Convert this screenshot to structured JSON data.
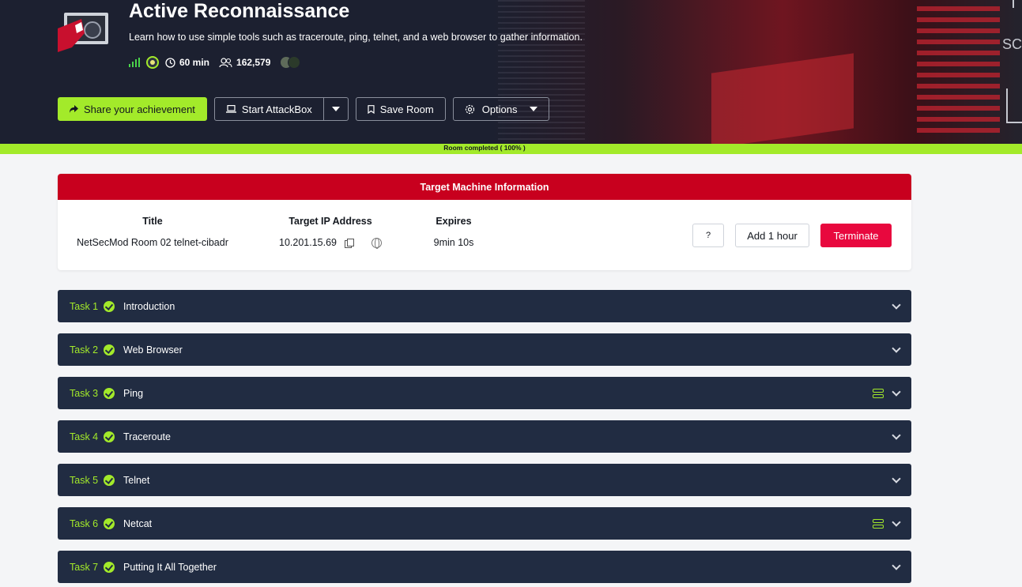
{
  "header": {
    "title": "Active Reconnaissance",
    "description": "Learn how to use simple tools such as traceroute, ping, telnet, and a web browser to gather information.",
    "duration": "60 min",
    "users": "162,579",
    "difficulty_icon": "difficulty-easy-icon",
    "art_text": "SC"
  },
  "actions": {
    "share": "Share your achievement",
    "attackbox": "Start AttackBox",
    "save": "Save Room",
    "options": "Options"
  },
  "progress": {
    "label": "Room completed ( 100% )",
    "percent": 100
  },
  "target_machine": {
    "heading": "Target Machine Information",
    "title_header": "Title",
    "title_value": "NetSecMod Room 02 telnet-cibadr",
    "ip_header": "Target IP Address",
    "ip_value": "10.201.15.69",
    "expires_header": "Expires",
    "expires_value": "9min 10s",
    "help_label": "?",
    "add_hour_label": "Add 1 hour",
    "terminate_label": "Terminate"
  },
  "tasks": [
    {
      "number": "Task 1",
      "name": "Introduction",
      "completed": true,
      "has_machine": false
    },
    {
      "number": "Task 2",
      "name": "Web Browser",
      "completed": true,
      "has_machine": false
    },
    {
      "number": "Task 3",
      "name": "Ping",
      "completed": true,
      "has_machine": true
    },
    {
      "number": "Task 4",
      "name": "Traceroute",
      "completed": true,
      "has_machine": false
    },
    {
      "number": "Task 5",
      "name": "Telnet",
      "completed": true,
      "has_machine": false
    },
    {
      "number": "Task 6",
      "name": "Netcat",
      "completed": true,
      "has_machine": true
    },
    {
      "number": "Task 7",
      "name": "Putting It All Together",
      "completed": true,
      "has_machine": false
    }
  ],
  "colors": {
    "accent": "#a3ea2a",
    "banner_bg": "#1c2030",
    "task_bg": "#212c42",
    "danger": "#c8001e",
    "terminate": "#e8083e"
  }
}
